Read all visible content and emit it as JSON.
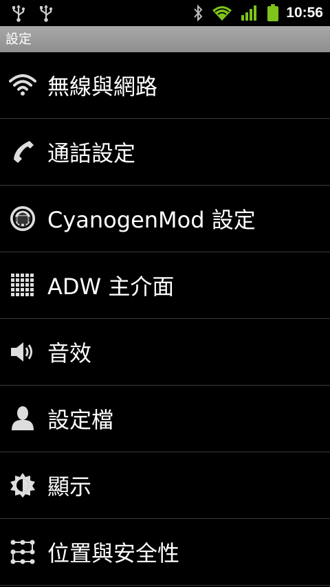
{
  "status": {
    "time": "10:56",
    "icons": [
      "usb-icon",
      "usb-icon",
      "bluetooth-icon",
      "wifi-signal-icon",
      "cell-signal-icon",
      "battery-icon"
    ],
    "accent_color": "#7fc31c"
  },
  "title": "設定",
  "items": [
    {
      "label": "無線與網路",
      "icon": "wifi-icon"
    },
    {
      "label": "通話設定",
      "icon": "phone-icon"
    },
    {
      "label": "CyanogenMod 設定",
      "icon": "cyanogen-android-icon"
    },
    {
      "label": "ADW 主介面",
      "icon": "app-grid-icon"
    },
    {
      "label": "音效",
      "icon": "speaker-icon"
    },
    {
      "label": "設定檔",
      "icon": "profile-person-icon"
    },
    {
      "label": "顯示",
      "icon": "brightness-icon"
    },
    {
      "label": "位置與安全性",
      "icon": "pattern-lock-icon"
    }
  ]
}
